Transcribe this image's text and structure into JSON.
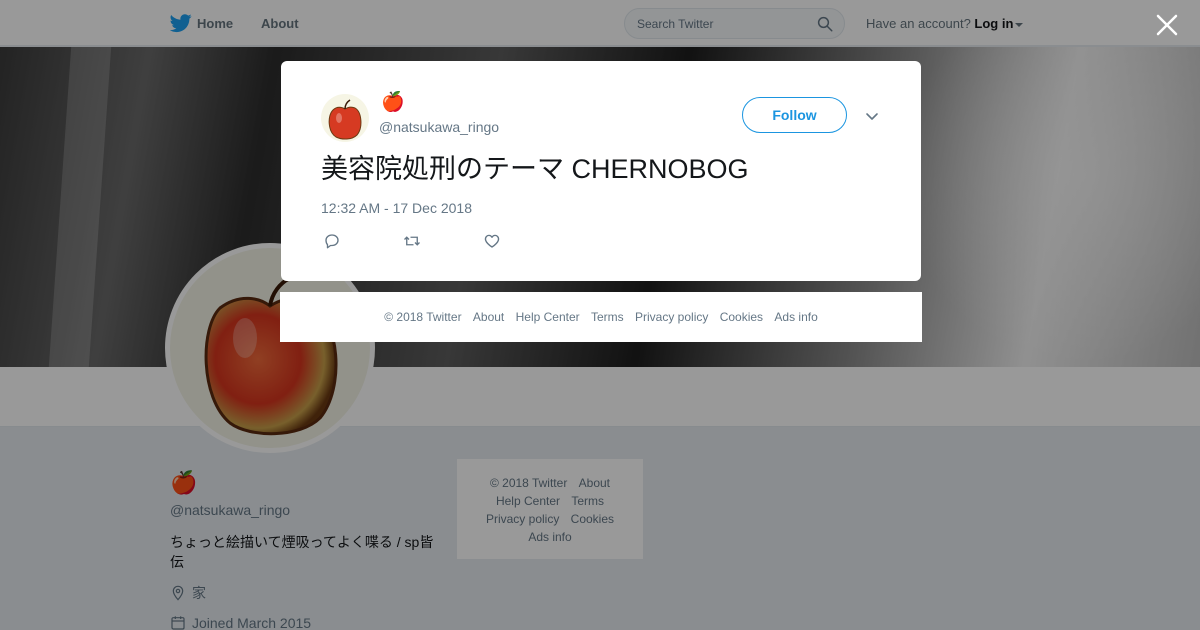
{
  "topbar": {
    "home_label": "Home",
    "about_label": "About",
    "search_placeholder": "Search Twitter",
    "account_prompt": "Have an account?",
    "login_label": "Log in"
  },
  "profile": {
    "name": "🍎",
    "handle": "@natsukawa_ringo",
    "bio": "ちょっと絵描いて煙吸ってよく喋る / sp皆伝",
    "location": "家",
    "joined": "Joined March 2015"
  },
  "side_footer": {
    "links": [
      "© 2018 Twitter",
      "About",
      "Help Center",
      "Terms",
      "Privacy policy",
      "Cookies",
      "Ads info"
    ]
  },
  "tweet": {
    "name": "🍎",
    "handle": "@natsukawa_ringo",
    "follow_label": "Follow",
    "text": "美容院処刑のテーマ CHERNOBOG",
    "timestamp": "12:32 AM - 17 Dec 2018"
  },
  "modal_footer": {
    "links": [
      "© 2018 Twitter",
      "About",
      "Help Center",
      "Terms",
      "Privacy policy",
      "Cookies",
      "Ads info"
    ]
  },
  "colors": {
    "accent": "#1b95e0",
    "twitter_blue": "#1da1f2",
    "muted_text": "#657786",
    "apple_red": "#c0131a"
  },
  "icons": {
    "logo": "twitter-bird-icon",
    "search": "search-icon",
    "close": "close-icon",
    "more": "chevron-down-icon",
    "reply": "reply-icon",
    "retweet": "retweet-icon",
    "like": "heart-icon",
    "location": "location-pin-icon",
    "joined": "calendar-icon"
  }
}
